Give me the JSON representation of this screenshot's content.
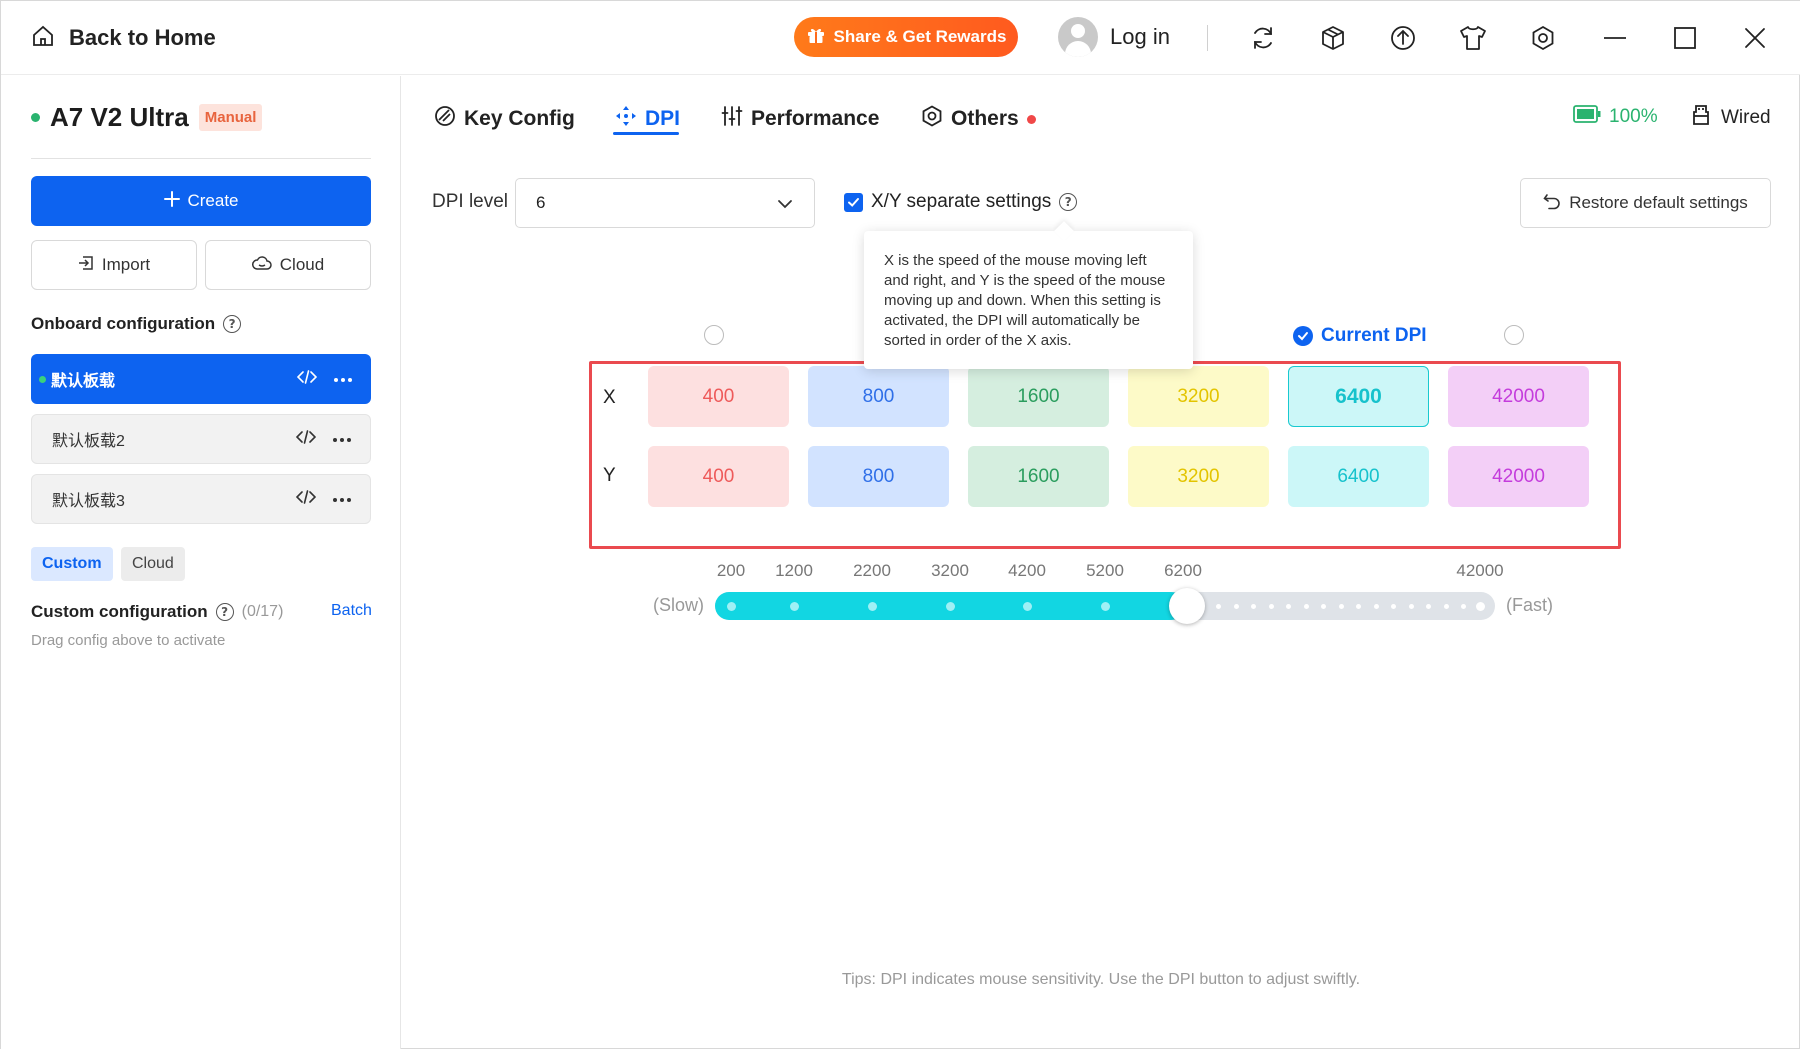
{
  "titlebar": {
    "back_label": "Back to Home",
    "share_label": "Share & Get Rewards",
    "login_label": "Log in"
  },
  "sidebar": {
    "device_name": "A7 V2 Ultra",
    "mode_badge": "Manual",
    "create_label": "Create",
    "import_label": "Import",
    "cloud_label": "Cloud",
    "onboard_title": "Onboard configuration",
    "profiles": [
      {
        "name": "默认板载",
        "active": true
      },
      {
        "name": "默认板载2",
        "active": false
      },
      {
        "name": "默认板载3",
        "active": false
      }
    ],
    "chip_custom": "Custom",
    "chip_cloud": "Cloud",
    "custom_title": "Custom configuration",
    "custom_count": "(0/17)",
    "batch_label": "Batch",
    "drag_hint": "Drag config above to activate"
  },
  "tabs": [
    {
      "label": "Key Config",
      "icon": "key-config-icon"
    },
    {
      "label": "DPI",
      "icon": "dpi-move-icon"
    },
    {
      "label": "Performance",
      "icon": "sliders-icon"
    },
    {
      "label": "Others",
      "icon": "hex-settings-icon"
    }
  ],
  "status": {
    "battery": "100%",
    "connection": "Wired"
  },
  "dpi": {
    "level_label": "DPI level",
    "level_value": "6",
    "xy_label": "X/Y separate settings",
    "xy_checked": true,
    "restore_label": "Restore default settings",
    "tooltip": "X is the speed of the mouse moving left and right, and Y is the speed of the mouse moving up and down. When this setting is activated, the DPI will automatically be sorted in order of the X axis.",
    "current_label": "Current DPI",
    "current_index": 4,
    "axis_x": "X",
    "axis_y": "Y",
    "x_values": [
      "400",
      "800",
      "1600",
      "3200",
      "6400",
      "42000"
    ],
    "y_values": [
      "400",
      "800",
      "1600",
      "3200",
      "6400",
      "42000"
    ],
    "cell_colors": [
      {
        "bg": "#fde0e0",
        "fg": "#ee5a5a"
      },
      {
        "bg": "#d2e3ff",
        "fg": "#2f6fe8"
      },
      {
        "bg": "#d5eedf",
        "fg": "#2a9d5e"
      },
      {
        "bg": "#fdfac8",
        "fg": "#e3c400"
      },
      {
        "bg": "#ccf7f8",
        "fg": "#16c2cc"
      },
      {
        "bg": "#f3cff7",
        "fg": "#c43cdc"
      }
    ]
  },
  "slider": {
    "ticks": [
      "200",
      "1200",
      "2200",
      "3200",
      "4200",
      "5200",
      "6200",
      "42000"
    ],
    "slow_label": "(Slow)",
    "fast_label": "(Fast)",
    "min": 200,
    "max": 42000,
    "value": 6200
  },
  "tips": "Tips: DPI indicates mouse sensitivity. Use the DPI button to adjust swiftly."
}
